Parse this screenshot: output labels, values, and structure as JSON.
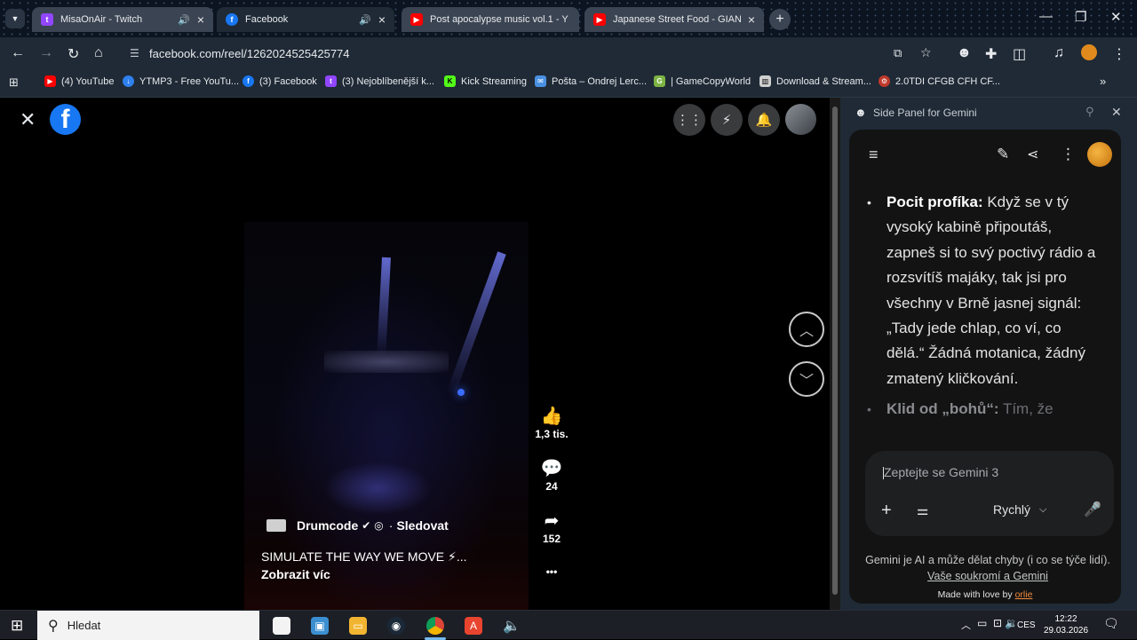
{
  "browser": {
    "tabs": [
      {
        "title": "MisaOnAir - Twitch",
        "icon": "twitch-icon",
        "color": "#9146ff",
        "audio": true
      },
      {
        "title": "Facebook",
        "icon": "facebook-icon",
        "color": "#1877f2",
        "audio": true,
        "active": true
      },
      {
        "title": "Post apocalypse music vol.1 - Y",
        "icon": "youtube-icon",
        "color": "#ff0000",
        "audio": false
      },
      {
        "title": "Japanese Street Food - GIANT",
        "icon": "youtube-icon",
        "color": "#ff0000",
        "audio": false
      }
    ],
    "url": "facebook.com/reel/1262024525425774",
    "bookmarks": [
      {
        "label": "(4) YouTube",
        "icon": "youtube-icon",
        "color": "#ff0000"
      },
      {
        "label": "YTMP3 - Free YouTu...",
        "icon": "ytmp3-icon",
        "color": "#2f80ed"
      },
      {
        "label": "(3) Facebook",
        "icon": "facebook-icon",
        "color": "#1877f2"
      },
      {
        "label": "(3) Nejoblíbenější k...",
        "icon": "twitch-icon",
        "color": "#9146ff"
      },
      {
        "label": "Kick Streaming",
        "icon": "kick-icon",
        "color": "#53fc18"
      },
      {
        "label": "Pošta – Ondrej Lerc...",
        "icon": "mail-icon",
        "color": "#4a90e2"
      },
      {
        "label": "| GameCopyWorld",
        "icon": "gamecopyworld-icon",
        "color": "#7cb342"
      },
      {
        "label": "Download & Stream...",
        "icon": "archive-icon",
        "color": "#cfcfcf"
      },
      {
        "label": "2.0TDI CFGB CFH CF...",
        "icon": "car-forum-icon",
        "color": "#c0392b"
      }
    ]
  },
  "reel": {
    "author": "Drumcode",
    "follow": "Sledovat",
    "caption": "SIMULATE THE WAY WE MOVE ⚡...",
    "show_more": "Zobrazit víc",
    "likes": "1,3 tis.",
    "comments": "24",
    "shares": "152",
    "more": "•••"
  },
  "gemini": {
    "title": "Side Panel for Gemini",
    "bullet1_bold": "Pocit profíka:",
    "bullet1_text": " Když se v tý vysoký kabině připoutáš, zapneš si to svý poctivý rádio a rozsvítíš majáky, tak jsi pro všechny v Brně jasnej signál: „Tady jede chlap, co ví, co dělá.“ Žádná motanica, žádný zmatený kličkování.",
    "bullet2_bold": "Klid od „bohů“:",
    "bullet2_text": " Tím, že",
    "prompt_placeholder": "Zeptejte se Gemini 3",
    "mode": "Rychlý",
    "disclaimer": "Gemini je AI a může dělat chyby (i co se týče lidí).",
    "privacy_link": "Vaše soukromí a Gemini",
    "made_with": "Made with love by",
    "made_by": "orlie"
  },
  "taskbar": {
    "search": "Hledat",
    "lang": "CES",
    "time": "12:22",
    "date": "29.03.2026"
  }
}
